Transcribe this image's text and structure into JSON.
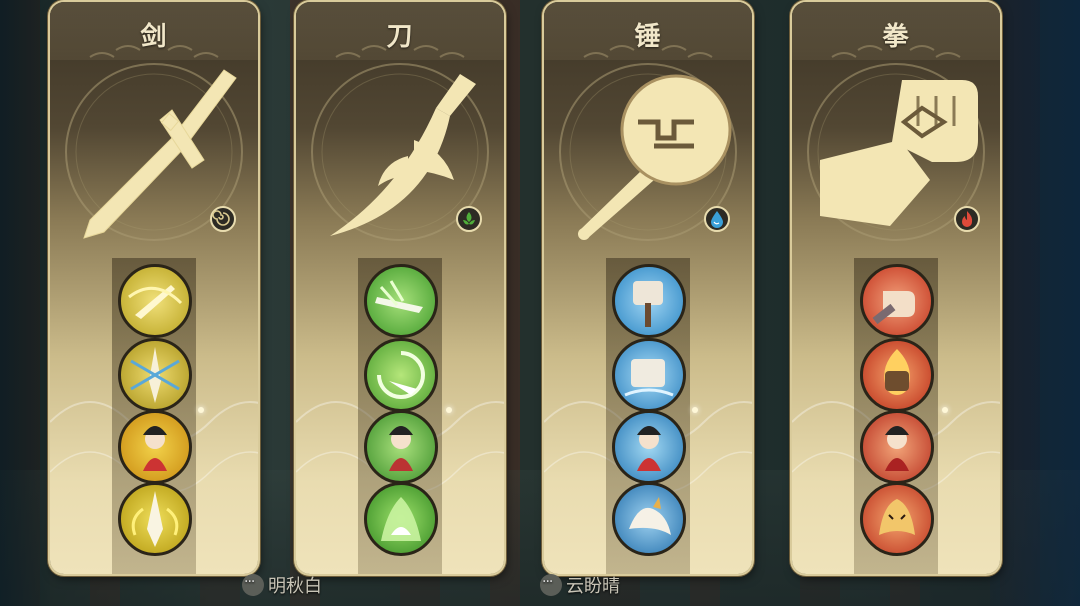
{
  "cards": [
    {
      "title": "剑",
      "weapon_icon": "sword-icon",
      "element_icon": "earth-swirl-icon",
      "element_color": "#d9c98f",
      "skills": [
        "sword-slash-skill-icon",
        "sword-burst-skill-icon",
        "sword-heroine-skill-icon",
        "sword-flame-skill-icon"
      ],
      "skill_theme": "#d8c43a"
    },
    {
      "title": "刀",
      "weapon_icon": "blade-icon",
      "element_icon": "wood-leaf-icon",
      "element_color": "#4fae3a",
      "skills": [
        "blade-strike-skill-icon",
        "blade-whirl-skill-icon",
        "blade-heroine-skill-icon",
        "blade-spirit-skill-icon"
      ],
      "skill_theme": "#5fb43b"
    },
    {
      "title": "锤",
      "weapon_icon": "hammer-icon",
      "element_icon": "water-drop-icon",
      "element_color": "#3aa0d8",
      "skills": [
        "hammer-smash-skill-icon",
        "hammer-quake-skill-icon",
        "hammer-heroine-skill-icon",
        "hammer-dragon-skill-icon"
      ],
      "skill_theme": "#3a9fd6"
    },
    {
      "title": "拳",
      "weapon_icon": "fist-icon",
      "element_icon": "fire-flame-icon",
      "element_color": "#e04a3a",
      "skills": [
        "fist-punch-skill-icon",
        "fist-flame-skill-icon",
        "fist-heroine-skill-icon",
        "fist-tiger-skill-icon"
      ],
      "skill_theme": "#d8442f"
    }
  ],
  "footer": {
    "names": [
      "明秋白",
      "云盼晴"
    ]
  }
}
